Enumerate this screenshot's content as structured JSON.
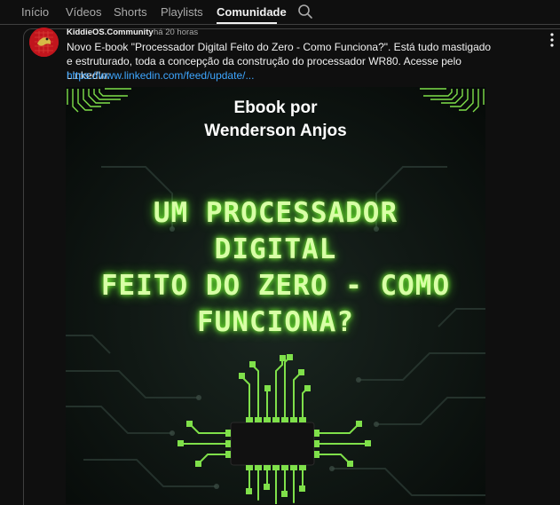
{
  "tabs": [
    {
      "label": "Início"
    },
    {
      "label": "Vídeos"
    },
    {
      "label": "Shorts"
    },
    {
      "label": "Playlists"
    },
    {
      "label": "Comunidade",
      "active": true
    }
  ],
  "post": {
    "channel": "KiddieOS.Community",
    "time": "há 20 horas",
    "text": "Novo E-book \"Processador Digital Feito do Zero - Como Funciona?\". Está tudo mastigado e estruturado, toda a concepção da construção do processador WR80. Acesse pelo LinkedIn:",
    "link": "https://www.linkedin.com/feed/update/...",
    "image": {
      "ebook_by": "Ebook por",
      "author": "Wenderson Anjos",
      "title_lines": [
        "UM PROCESSADOR",
        "DIGITAL",
        "FEITO DO ZERO - COMO",
        "FUNCIONA?"
      ]
    }
  },
  "colors": {
    "background": "#0f0f0f",
    "link": "#3ea6ff",
    "neon_green": "#7fff33",
    "avatar_red": "#c1151d"
  },
  "icons": {
    "search": "search-icon",
    "menu": "more-vert-icon",
    "avatar": "channel-avatar"
  }
}
